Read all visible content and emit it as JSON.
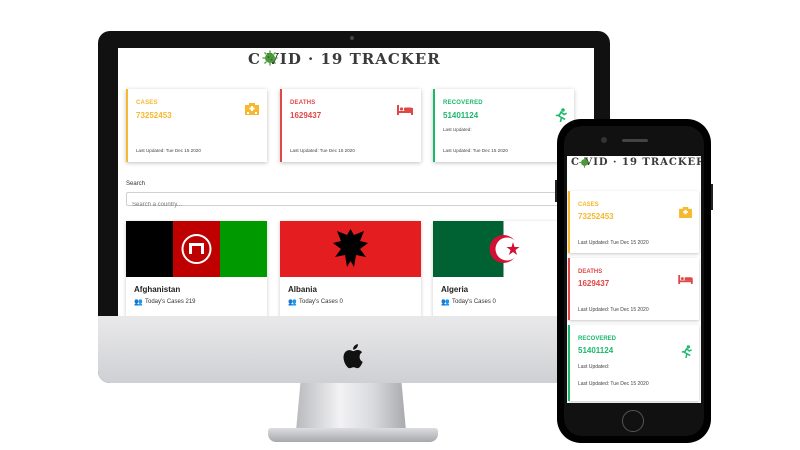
{
  "app": {
    "title": "C VID · 19 TRACKER"
  },
  "stats": {
    "cases": {
      "label": "CASES",
      "value": "73252453",
      "updated": "Last Updated: Tue Dec 15 2020",
      "color": "#f5b82e",
      "icon": "hospital-icon"
    },
    "deaths": {
      "label": "DEATHS",
      "value": "1629437",
      "updated": "Last Updated: Tue Dec 15 2020",
      "color": "#e04848",
      "icon": "bed-icon"
    },
    "recovered": {
      "label": "RECOVERED",
      "value": "51401124",
      "updated_prefix": "Last Updated:",
      "updated": "Last Updated: Tue Dec 15 2020",
      "color": "#1cb86b",
      "icon": "running-person-icon"
    }
  },
  "search": {
    "label": "Search",
    "placeholder": "Search a country..."
  },
  "countries": [
    {
      "name": "Afghanistan",
      "today_cases": "Today's Cases 219",
      "flag": "afghanistan-flag"
    },
    {
      "name": "Albania",
      "today_cases": "Today's Cases 0",
      "flag": "albania-flag"
    },
    {
      "name": "Algeria",
      "today_cases": "Today's Cases 0",
      "flag": "algeria-flag"
    }
  ],
  "colors": {
    "cases": "#f5b82e",
    "deaths": "#e04848",
    "recovered": "#1cb86b",
    "virus_green": "#4a9a3a"
  }
}
